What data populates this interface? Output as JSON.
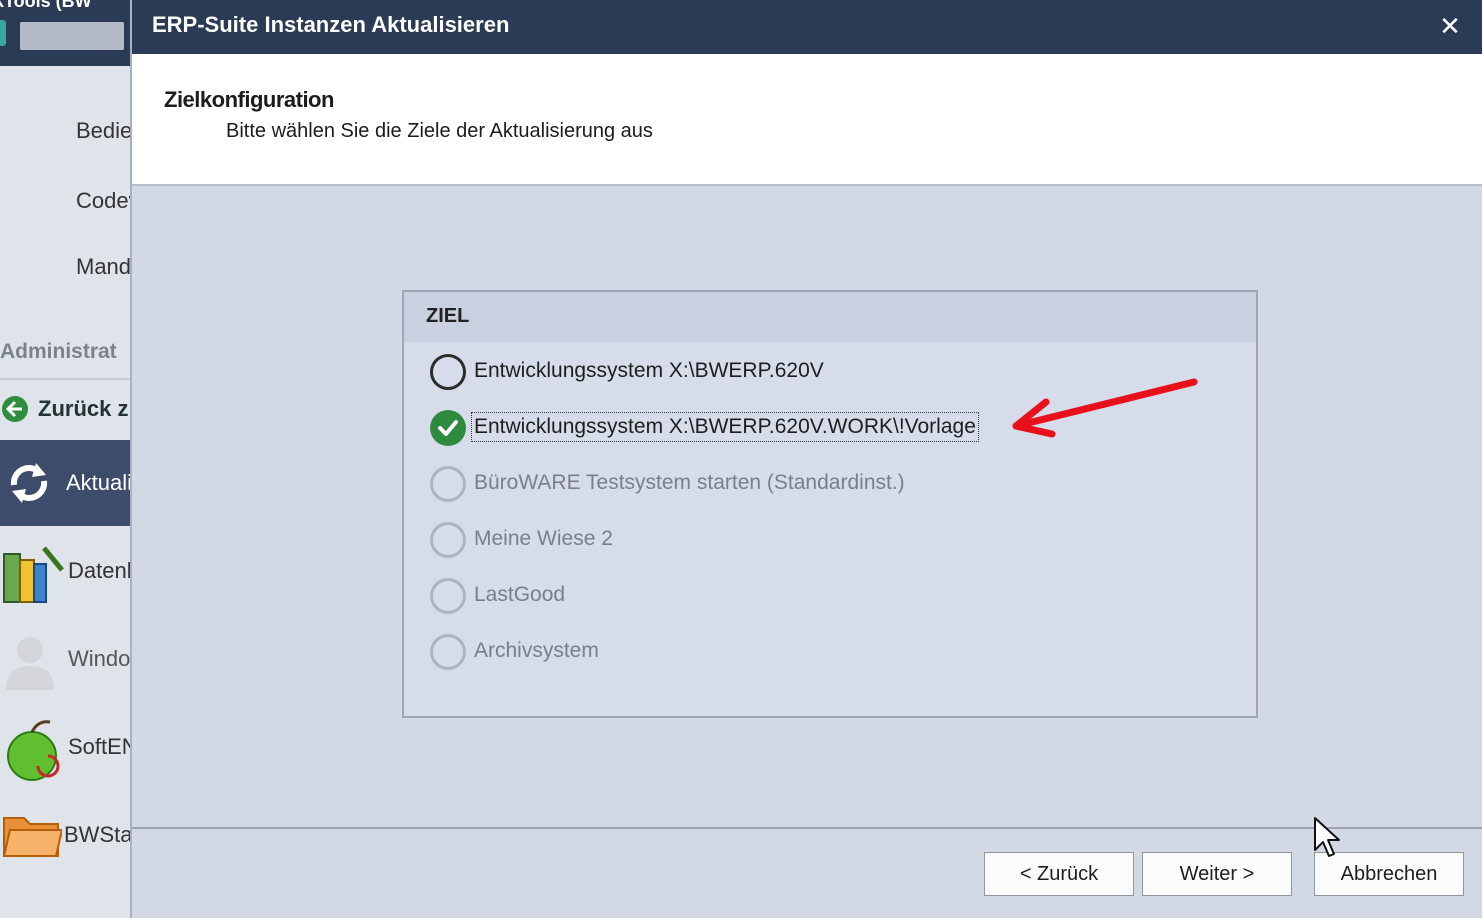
{
  "background_app": {
    "title": "XTools (BW",
    "nav_items": [
      "Bedie",
      "Codev",
      "Mand"
    ],
    "section_label": "Administrat",
    "back_label": "Zurück z",
    "active_item": "Aktuali",
    "items": [
      {
        "label": "Datenl",
        "icon": "database-tools-icon"
      },
      {
        "label": "Windo",
        "icon": "user-icon"
      },
      {
        "label": "SoftEN",
        "icon": "apple-icon"
      },
      {
        "label": "BWSta",
        "icon": "folder-icon"
      }
    ]
  },
  "dialog": {
    "title": "ERP-Suite Instanzen Aktualisieren",
    "close_glyph": "✕",
    "header": {
      "title": "Zielkonfiguration",
      "subtitle": "Bitte wählen Sie die Ziele der Aktualisierung aus"
    },
    "group": {
      "title": "ZIEL",
      "options": [
        {
          "label": "Entwicklungssystem X:\\BWERP.620V",
          "checked": false,
          "enabled": true
        },
        {
          "label": "Entwicklungssystem X:\\BWERP.620V.WORK\\!Vorlage",
          "checked": true,
          "enabled": true
        },
        {
          "label": "BüroWARE Testsystem starten (Standardinst.)",
          "checked": false,
          "enabled": false
        },
        {
          "label": "Meine Wiese 2",
          "checked": false,
          "enabled": false
        },
        {
          "label": "LastGood",
          "checked": false,
          "enabled": false
        },
        {
          "label": "Archivsystem",
          "checked": false,
          "enabled": false
        }
      ]
    },
    "buttons": {
      "back": "< Zurück",
      "next": "Weiter >",
      "cancel": "Abbrechen"
    }
  },
  "colors": {
    "title_bar": "#2b3a55",
    "checked_radio": "#2e8b3d",
    "annotation_arrow": "#e8111b"
  }
}
